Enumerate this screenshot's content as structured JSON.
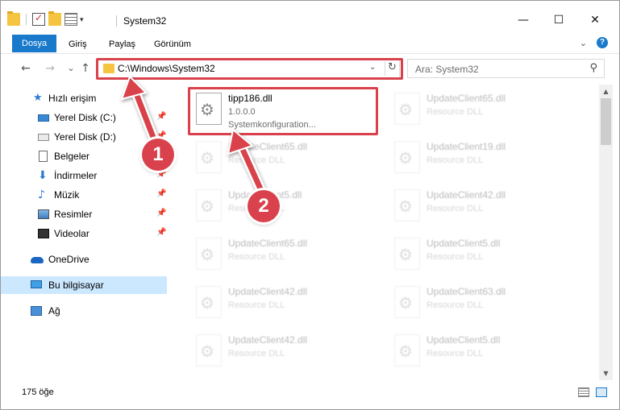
{
  "window": {
    "title": "System32",
    "controls": {
      "minimize": "—",
      "maximize": "☐",
      "close": "✕"
    }
  },
  "ribbon": {
    "tabs": [
      {
        "label": "Dosya",
        "active": true
      },
      {
        "label": "Giriş"
      },
      {
        "label": "Paylaş"
      },
      {
        "label": "Görünüm"
      }
    ],
    "expand_icon": "chevron-down-icon",
    "help_label": "?"
  },
  "navbar": {
    "back": "←",
    "forward": "→",
    "recent": "⌄",
    "up": "↑",
    "address": "C:\\Windows\\System32",
    "search_placeholder": "Ara: System32"
  },
  "sidebar": {
    "items": [
      {
        "label": "Hızlı erişim",
        "icon": "star-icon"
      },
      {
        "label": "Yerel Disk (C:)",
        "icon": "drive-icon",
        "pinned": true
      },
      {
        "label": "Yerel Disk (D:)",
        "icon": "drive-icon",
        "pinned": true
      },
      {
        "label": "Belgeler",
        "icon": "documents-icon",
        "pinned": true
      },
      {
        "label": "İndirmeler",
        "icon": "download-icon",
        "pinned": true
      },
      {
        "label": "Müzik",
        "icon": "music-icon",
        "pinned": true
      },
      {
        "label": "Resimler",
        "icon": "pictures-icon",
        "pinned": true
      },
      {
        "label": "Videolar",
        "icon": "video-icon",
        "pinned": true
      },
      {
        "label": "OneDrive",
        "icon": "cloud-icon"
      },
      {
        "label": "Bu bilgisayar",
        "icon": "computer-icon",
        "selected": true
      },
      {
        "label": "Ağ",
        "icon": "network-icon"
      }
    ]
  },
  "files": {
    "focused": {
      "name": "tipp186.dll",
      "version": "1.0.0.0",
      "description": "Systemkonfiguration..."
    },
    "left_column": [
      {
        "name": "UpdateClient65.dll",
        "description": "Resource DLL"
      },
      {
        "name": "UpdateClient5.dll",
        "description": "Resource DLL"
      },
      {
        "name": "UpdateClient65.dll",
        "description": "Resource DLL"
      },
      {
        "name": "UpdateClient42.dll",
        "description": "Resource DLL"
      },
      {
        "name": "UpdateClient42.dll",
        "description": "Resource DLL"
      }
    ],
    "right_column": [
      {
        "name": "UpdateClient65.dll",
        "description": "Resource DLL"
      },
      {
        "name": "UpdateClient19.dll",
        "description": "Resource DLL"
      },
      {
        "name": "UpdateClient42.dll",
        "description": "Resource DLL"
      },
      {
        "name": "UpdateClient5.dll",
        "description": "Resource DLL"
      },
      {
        "name": "UpdateClient63.dll",
        "description": "Resource DLL"
      },
      {
        "name": "UpdateClient5.dll",
        "description": "Resource DLL"
      }
    ]
  },
  "statusbar": {
    "count": "175 öğe"
  },
  "annotations": {
    "step1": "1",
    "step2": "2",
    "highlight_color": "#d9424c"
  },
  "colors": {
    "accent": "#1979ca",
    "selection": "#cce8ff"
  }
}
